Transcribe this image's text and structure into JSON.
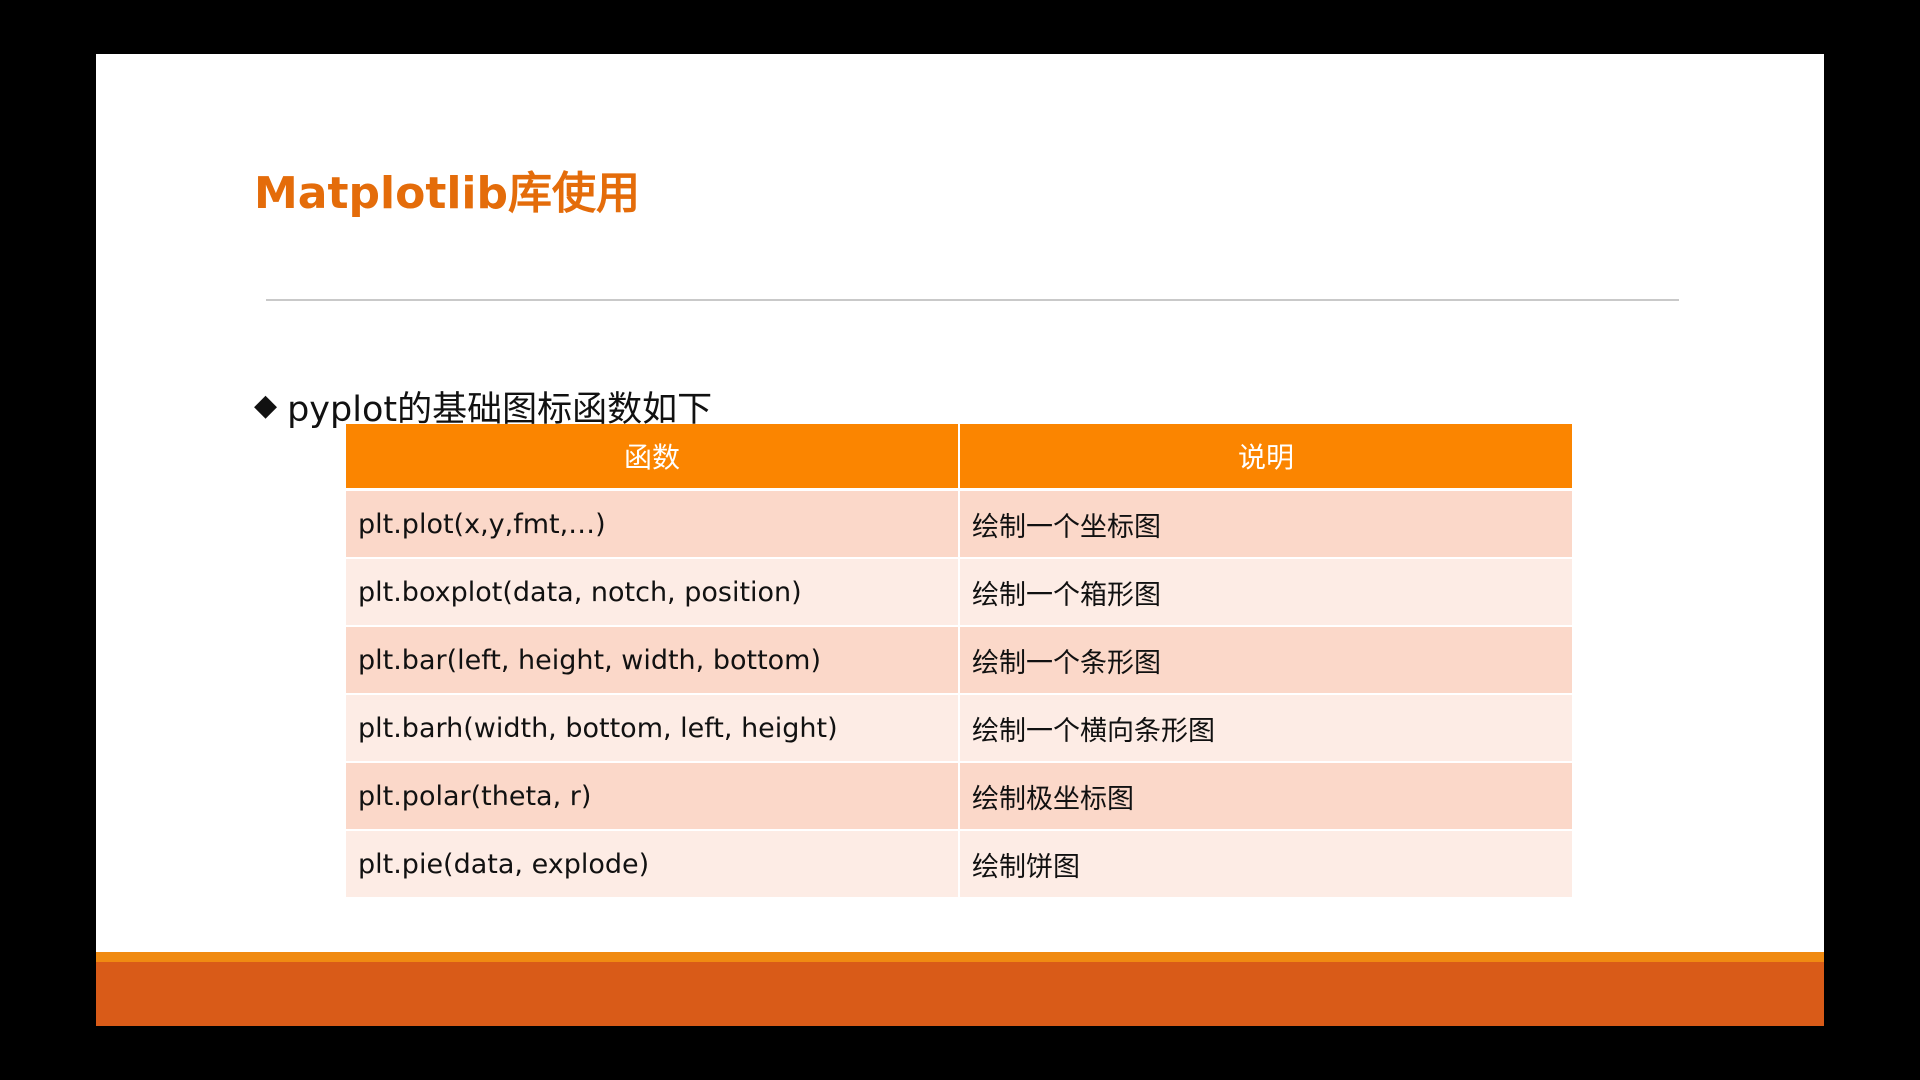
{
  "slide": {
    "title": "Matplotlib库使用",
    "bullet": {
      "icon": "diamond-bullet",
      "text": "pyplot的基础图标函数如下"
    },
    "table": {
      "headers": [
        "函数",
        "说明"
      ],
      "rows": [
        [
          "plt.plot(x,y,fmt,…)",
          "绘制一个坐标图"
        ],
        [
          "plt.boxplot(data, notch, position)",
          "绘制一个箱形图"
        ],
        [
          "plt.bar(left, height, width, bottom)",
          "绘制一个条形图"
        ],
        [
          "plt.barh(width, bottom, left, height)",
          "绘制一个横向条形图"
        ],
        [
          "plt.polar(theta, r)",
          "绘制极坐标图"
        ],
        [
          "plt.pie(data, explode)",
          "绘制饼图"
        ]
      ]
    }
  },
  "colors": {
    "title": "#e46c0a",
    "header": "#fb8500",
    "row_odd": "#fbd8c9",
    "row_even": "#fdece5",
    "footer": "#d95b18",
    "footer_line": "#f08a12"
  }
}
